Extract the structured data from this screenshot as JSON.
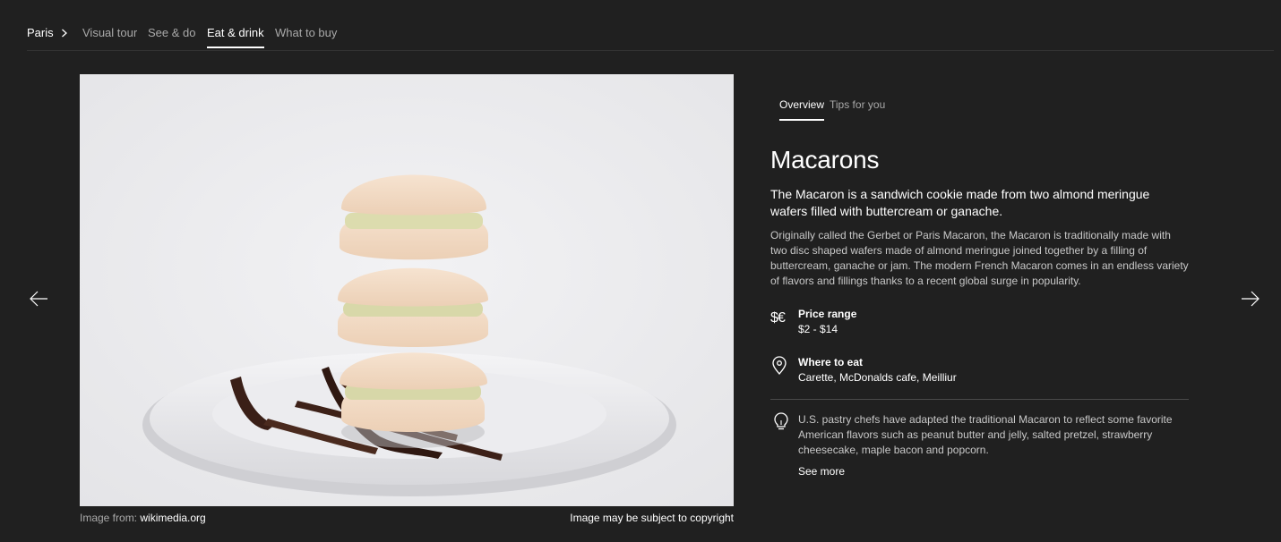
{
  "nav": {
    "breadcrumb": "Paris",
    "tabs": [
      {
        "label": "Visual tour"
      },
      {
        "label": "See & do"
      },
      {
        "label": "Eat & drink"
      },
      {
        "label": "What to buy"
      }
    ],
    "active_tab": "Eat & drink"
  },
  "image": {
    "source_prefix": "Image from: ",
    "source": "wikimedia.org",
    "copyright": "Image may be subject to copyright"
  },
  "detail": {
    "tabs": [
      {
        "label": "Overview"
      },
      {
        "label": "Tips for you"
      }
    ],
    "active_tab": "Overview",
    "title": "Macarons",
    "lead": "The Macaron is a sandwich cookie made from two almond meringue wafers filled with buttercream or ganache.",
    "description": "Originally called the Gerbet or Paris Macaron, the Macaron is traditionally made with two disc shaped wafers made of almond meringue joined together by a filling of buttercream, ganache or jam. The modern French Macaron comes in an endless variety of flavors and fillings thanks to a recent global surge in popularity.",
    "price": {
      "label": "Price range",
      "value": "$2 - $14",
      "icon": "currency-icon"
    },
    "where": {
      "label": "Where to eat",
      "value": "Carette, McDonalds cafe, Meilliur",
      "icon": "location-pin-icon"
    },
    "tip": {
      "text": "U.S. pastry chefs have adapted the traditional Macaron to reflect some favorite American flavors such as peanut butter and jelly, salted pretzel, strawberry cheesecake, maple bacon and popcorn.",
      "more": "See more",
      "icon": "lightbulb-icon"
    }
  },
  "colors": {
    "background": "#202020",
    "text": "#ffffff",
    "muted": "#a9a9a9"
  }
}
